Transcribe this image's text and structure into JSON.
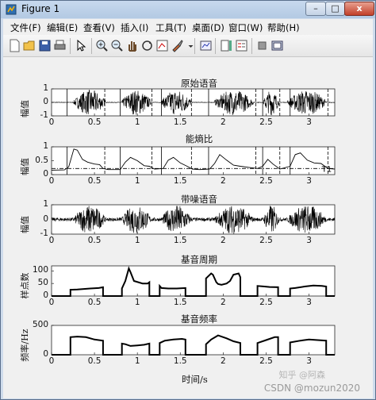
{
  "window": {
    "title": "Figure 1",
    "min": "–",
    "max": "□",
    "close": "x"
  },
  "menu": [
    "文件(F)",
    "编辑(E)",
    "查看(V)",
    "插入(I)",
    "工具(T)",
    "桌面(D)",
    "窗口(W)",
    "帮助(H)"
  ],
  "watermark": {
    "line1": "知乎 @阿森",
    "line2": "CSDN @mozun2020"
  },
  "chart_data": [
    {
      "type": "line",
      "title": "原始语音",
      "ylabel": "幅值",
      "xlim": [
        0,
        3.3
      ],
      "ylim": [
        -1,
        1
      ],
      "yticks": [
        "1",
        "0",
        "-1"
      ],
      "xticks": [
        "0",
        "0.5",
        "1",
        "1.5",
        "2",
        "2.5",
        "3"
      ],
      "segments": [
        [
          0.26,
          0.63
        ],
        [
          0.82,
          1.16
        ],
        [
          1.28,
          1.63
        ],
        [
          1.9,
          2.35
        ],
        [
          2.47,
          2.65
        ],
        [
          2.75,
          3.2
        ]
      ],
      "boundaries": [
        0.18,
        0.62,
        0.8,
        1.17,
        1.28,
        1.63,
        1.83,
        2.38,
        2.46,
        2.66,
        2.78,
        3.22
      ]
    },
    {
      "type": "line",
      "title": "能熵比",
      "ylabel": "幅值",
      "xlim": [
        0,
        3.3
      ],
      "ylim": [
        0,
        1
      ],
      "yticks": [
        "1",
        "0.5",
        "0"
      ],
      "xticks": [
        "0",
        "0.5",
        "1",
        "1.5",
        "2",
        "2.5",
        "3"
      ],
      "threshold_label": "T1",
      "threshold": 0.22,
      "x": [
        0,
        0.15,
        0.2,
        0.26,
        0.3,
        0.36,
        0.42,
        0.5,
        0.56,
        0.6,
        0.66,
        0.8,
        0.86,
        0.92,
        1.0,
        1.08,
        1.14,
        1.2,
        1.3,
        1.36,
        1.42,
        1.5,
        1.58,
        1.64,
        1.72,
        1.84,
        1.9,
        1.96,
        2.04,
        2.12,
        2.2,
        2.3,
        2.4,
        2.46,
        2.52,
        2.58,
        2.66,
        2.78,
        2.84,
        2.9,
        2.98,
        3.06,
        3.14,
        3.22,
        3.3
      ],
      "y": [
        0.16,
        0.17,
        0.28,
        0.92,
        0.88,
        0.55,
        0.45,
        0.38,
        0.36,
        0.22,
        0.18,
        0.18,
        0.45,
        0.62,
        0.5,
        0.32,
        0.3,
        0.2,
        0.22,
        0.52,
        0.62,
        0.42,
        0.3,
        0.2,
        0.18,
        0.2,
        0.4,
        0.72,
        0.52,
        0.34,
        0.3,
        0.26,
        0.22,
        0.3,
        0.55,
        0.38,
        0.2,
        0.3,
        0.72,
        0.78,
        0.52,
        0.42,
        0.4,
        0.22,
        0.2
      ]
    },
    {
      "type": "line",
      "title": "带噪语音",
      "ylabel": "幅值",
      "xlim": [
        0,
        3.3
      ],
      "ylim": [
        -1,
        1
      ],
      "yticks": [
        "1",
        "0",
        "-1"
      ],
      "xticks": [
        "0",
        "0.5",
        "1",
        "1.5",
        "2",
        "2.5",
        "3"
      ]
    },
    {
      "type": "line",
      "title": "基音周期",
      "ylabel": "样点数",
      "xlim": [
        0,
        3.3
      ],
      "ylim": [
        0,
        120
      ],
      "yticks": [
        "100",
        "50",
        "0"
      ],
      "xticks": [
        "0",
        "0.5",
        "1",
        "1.5",
        "2",
        "2.5",
        "3"
      ],
      "x": [
        0,
        0.22,
        0.22,
        0.3,
        0.45,
        0.55,
        0.6,
        0.6,
        0.82,
        0.82,
        0.86,
        0.9,
        0.92,
        0.96,
        1.06,
        1.12,
        1.14,
        1.14,
        1.26,
        1.26,
        1.28,
        1.36,
        1.46,
        1.56,
        1.56,
        1.8,
        1.8,
        1.86,
        1.88,
        1.92,
        1.94,
        1.98,
        2.04,
        2.08,
        2.12,
        2.18,
        2.2,
        2.2,
        2.4,
        2.4,
        2.48,
        2.54,
        2.64,
        2.64,
        2.78,
        2.78,
        2.84,
        2.95,
        3.05,
        3.15,
        3.2,
        3.2,
        3.3
      ],
      "y": [
        0,
        0,
        25,
        26,
        30,
        32,
        35,
        0,
        0,
        30,
        60,
        110,
        95,
        60,
        50,
        50,
        55,
        0,
        0,
        40,
        32,
        30,
        30,
        32,
        0,
        0,
        70,
        90,
        85,
        55,
        48,
        45,
        50,
        60,
        85,
        90,
        75,
        0,
        0,
        40,
        38,
        36,
        35,
        0,
        0,
        30,
        32,
        38,
        42,
        40,
        38,
        0,
        0
      ]
    },
    {
      "type": "line",
      "title": "基音频率",
      "ylabel": "频率/Hz",
      "xlabel": "时间/s",
      "xlim": [
        0,
        3.3
      ],
      "ylim": [
        0,
        500
      ],
      "yticks": [
        "500",
        "0"
      ],
      "xticks": [
        "0",
        "0.5",
        "1",
        "1.5",
        "2",
        "2.5",
        "3"
      ],
      "x": [
        0,
        0.22,
        0.22,
        0.3,
        0.4,
        0.5,
        0.6,
        0.6,
        0.82,
        0.82,
        0.86,
        0.92,
        1.0,
        1.08,
        1.14,
        1.14,
        1.26,
        1.26,
        1.32,
        1.42,
        1.52,
        1.56,
        1.56,
        1.8,
        1.8,
        1.86,
        1.94,
        2.04,
        2.12,
        2.2,
        2.2,
        2.4,
        2.4,
        2.5,
        2.6,
        2.64,
        2.64,
        2.78,
        2.78,
        2.9,
        3.0,
        3.1,
        3.2,
        3.2,
        3.3
      ],
      "y": [
        0,
        0,
        300,
        310,
        300,
        260,
        240,
        0,
        0,
        190,
        180,
        150,
        160,
        170,
        190,
        0,
        0,
        200,
        240,
        260,
        270,
        260,
        0,
        0,
        180,
        260,
        330,
        280,
        230,
        200,
        0,
        0,
        200,
        250,
        300,
        300,
        0,
        0,
        210,
        240,
        260,
        250,
        240,
        0,
        0
      ]
    }
  ]
}
